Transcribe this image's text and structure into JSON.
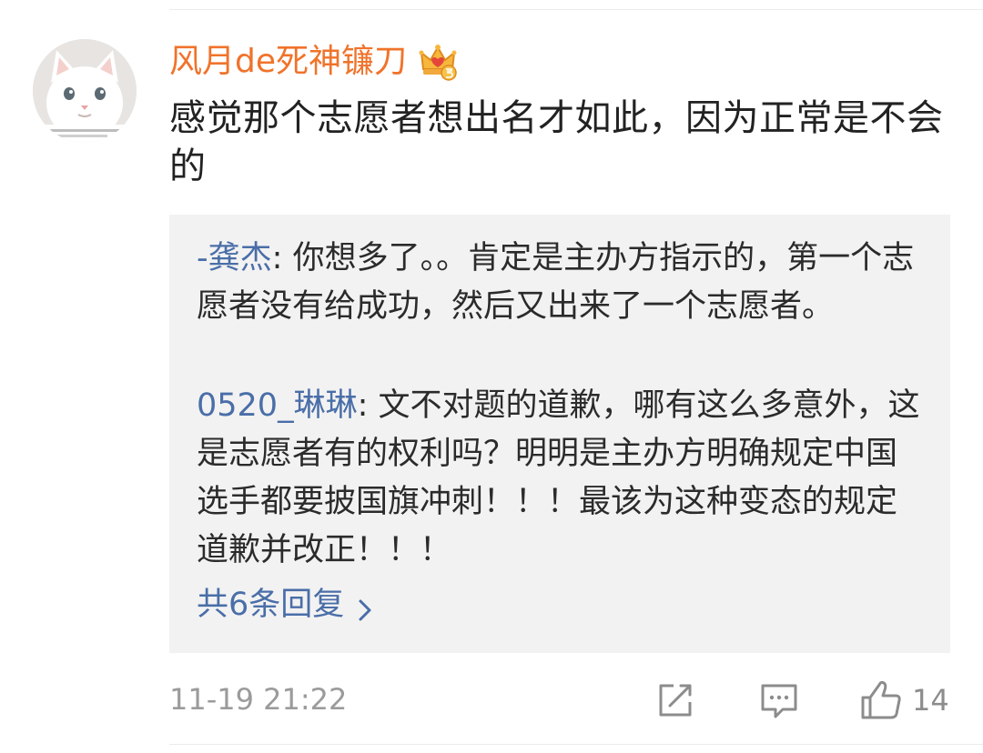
{
  "comment": {
    "username": "风月de死神镰刀",
    "badge_icon": "crown-vip-badge-icon",
    "avatar_icon": "white-cat-avatar",
    "text": "感觉那个志愿者想出名才如此，因为正常是不会的",
    "timestamp": "11-19 21:22",
    "like_count": "14"
  },
  "replies": [
    {
      "user": "-龚杰",
      "separator": ": ",
      "text": "你想多了。。肯定是主办方指示的，第一个志愿者没有给成功，然后又出来了一个志愿者。"
    },
    {
      "user": "0520_琳琳",
      "separator": ": ",
      "text": "文不对题的道歉，哪有这么多意外，这是志愿者有的权利吗？明明是主办方明确规定中国选手都要披国旗冲刺！！！最该为这种变态的规定道歉并改正！！！"
    }
  ],
  "more_replies_label": "共6条回复",
  "actions": {
    "share_icon": "share-icon",
    "comment_icon": "comment-icon",
    "like_icon": "thumbs-up-icon"
  },
  "colors": {
    "username": "#f0732b",
    "link": "#4a6ea8",
    "reply_background": "#f2f2f2",
    "muted": "#9b9b9b"
  }
}
